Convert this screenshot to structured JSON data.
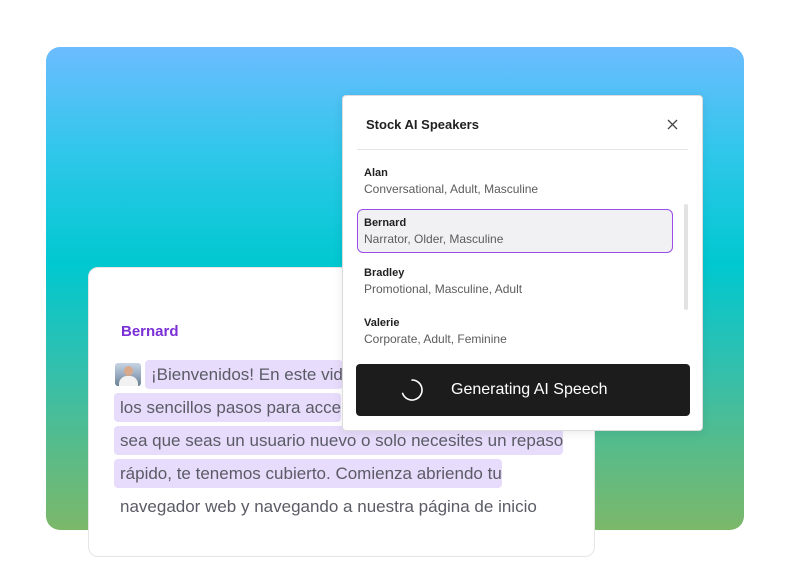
{
  "doc": {
    "speaker_name": "Bernard",
    "lines": [
      "¡Bienvenidos! En este vid",
      "los sencillos pasos para acce",
      "sea que seas un usuario nuevo o solo necesites un repaso",
      "rápido, te tenemos cubierto. Comienza abriendo tu",
      "navegador web y navegando a nuestra página de inicio"
    ]
  },
  "popup": {
    "title": "Stock AI Speakers",
    "close_icon": "close-icon",
    "speakers": [
      {
        "name": "Alan",
        "description": "Conversational, Adult, Masculine",
        "selected": false
      },
      {
        "name": "Bernard",
        "description": "Narrator, Older, Masculine",
        "selected": true
      },
      {
        "name": "Bradley",
        "description": "Promotional, Masculine, Adult",
        "selected": false
      },
      {
        "name": "Valerie",
        "description": "Corporate, Adult, Feminine",
        "selected": false
      }
    ],
    "generate_label": "Generating AI Speech",
    "spinner_icon": "spinner-icon"
  },
  "colors": {
    "accent": "#9a4ee6",
    "speaker_name": "#7b2fd6",
    "highlight": "#e7dcfb",
    "button": "#1c1c1c"
  }
}
